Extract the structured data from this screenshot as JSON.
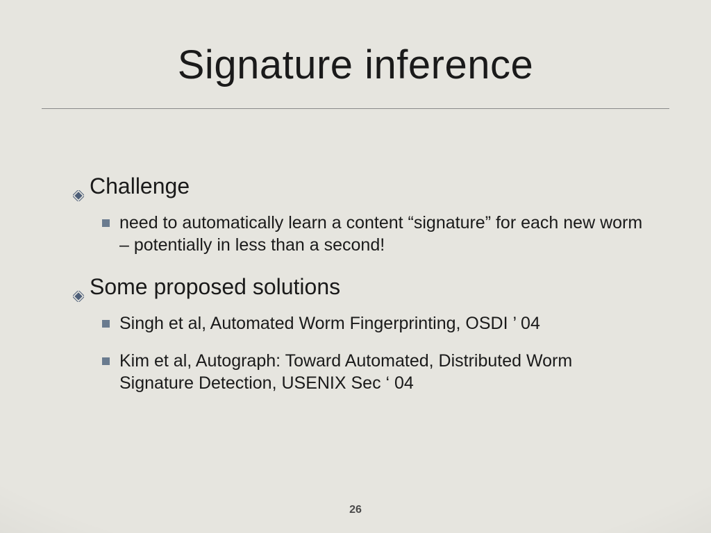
{
  "title": "Signature inference",
  "sections": [
    {
      "heading": "Challenge",
      "items": [
        "need to automatically learn a content “signature” for each new worm – potentially in less than a second!"
      ]
    },
    {
      "heading": "Some proposed solutions",
      "items": [
        "Singh et al, Automated Worm Fingerprinting, OSDI ’ 04",
        "Kim et al, Autograph: Toward Automated, Distributed Worm Signature Detection, USENIX Sec ‘ 04"
      ]
    }
  ],
  "page_number": "26"
}
